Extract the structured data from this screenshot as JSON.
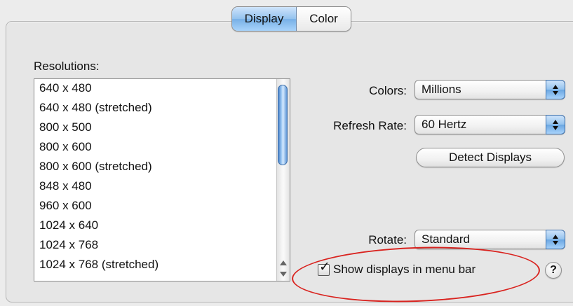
{
  "tabs": [
    {
      "label": "Display",
      "selected": true
    },
    {
      "label": "Color",
      "selected": false
    }
  ],
  "resolutions": {
    "label": "Resolutions:",
    "items": [
      "640 x 480",
      "640 x 480 (stretched)",
      "800 x 500",
      "800 x 600",
      "800 x 600 (stretched)",
      "848 x 480",
      "960 x 600",
      "1024 x 640",
      "1024 x 768",
      "1024 x 768 (stretched)"
    ]
  },
  "colors": {
    "label": "Colors:",
    "value": "Millions"
  },
  "refresh_rate": {
    "label": "Refresh Rate:",
    "value": "60 Hertz"
  },
  "detect_button": {
    "label": "Detect Displays"
  },
  "rotate": {
    "label": "Rotate:",
    "value": "Standard"
  },
  "menu_bar_checkbox": {
    "label": "Show displays in menu bar",
    "checked": true
  },
  "help": {
    "label": "?"
  },
  "accent_colors": {
    "selection_blue": "#77b0e6",
    "annotation_red": "#d9231f"
  }
}
